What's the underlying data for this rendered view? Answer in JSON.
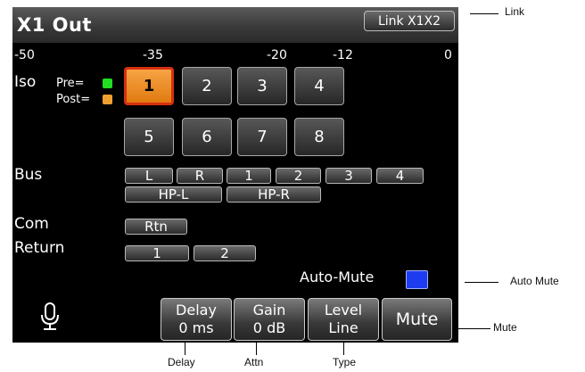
{
  "header": {
    "title": "X1 Out",
    "link_button": "Link X1X2"
  },
  "scale": [
    "-50",
    "-35",
    "-20",
    "-12",
    "0"
  ],
  "rows": {
    "iso": "Iso",
    "bus": "Bus",
    "com": "Com",
    "return": "Return"
  },
  "legend": {
    "pre": "Pre=",
    "post": "Post=",
    "pre_color": "#22dd22",
    "post_color": "#f0a030"
  },
  "iso_buttons": [
    "1",
    "2",
    "3",
    "4",
    "5",
    "6",
    "7",
    "8"
  ],
  "iso_selected": "1",
  "bus_buttons": [
    "L",
    "R",
    "1",
    "2",
    "3",
    "4",
    "HP-L",
    "HP-R"
  ],
  "com_buttons": [
    "Rtn"
  ],
  "return_buttons": [
    "1",
    "2"
  ],
  "auto_mute": {
    "label": "Auto-Mute",
    "color": "#1d3cf0"
  },
  "bottom_bar": {
    "delay": {
      "title": "Delay",
      "value": "0 ms"
    },
    "gain": {
      "title": "Gain",
      "value": "0 dB"
    },
    "level": {
      "title": "Level",
      "value": "Line"
    },
    "mute": "Mute",
    "mic_icon": "microphone-icon"
  },
  "callouts": {
    "link": "Link",
    "auto_mute": "Auto Mute",
    "mute": "Mute",
    "delay": "Delay",
    "attn": "Attn",
    "type": "Type"
  },
  "colors": {
    "selected_fill": "#f09030",
    "selected_border": "#d72f10",
    "background": "#000000"
  }
}
